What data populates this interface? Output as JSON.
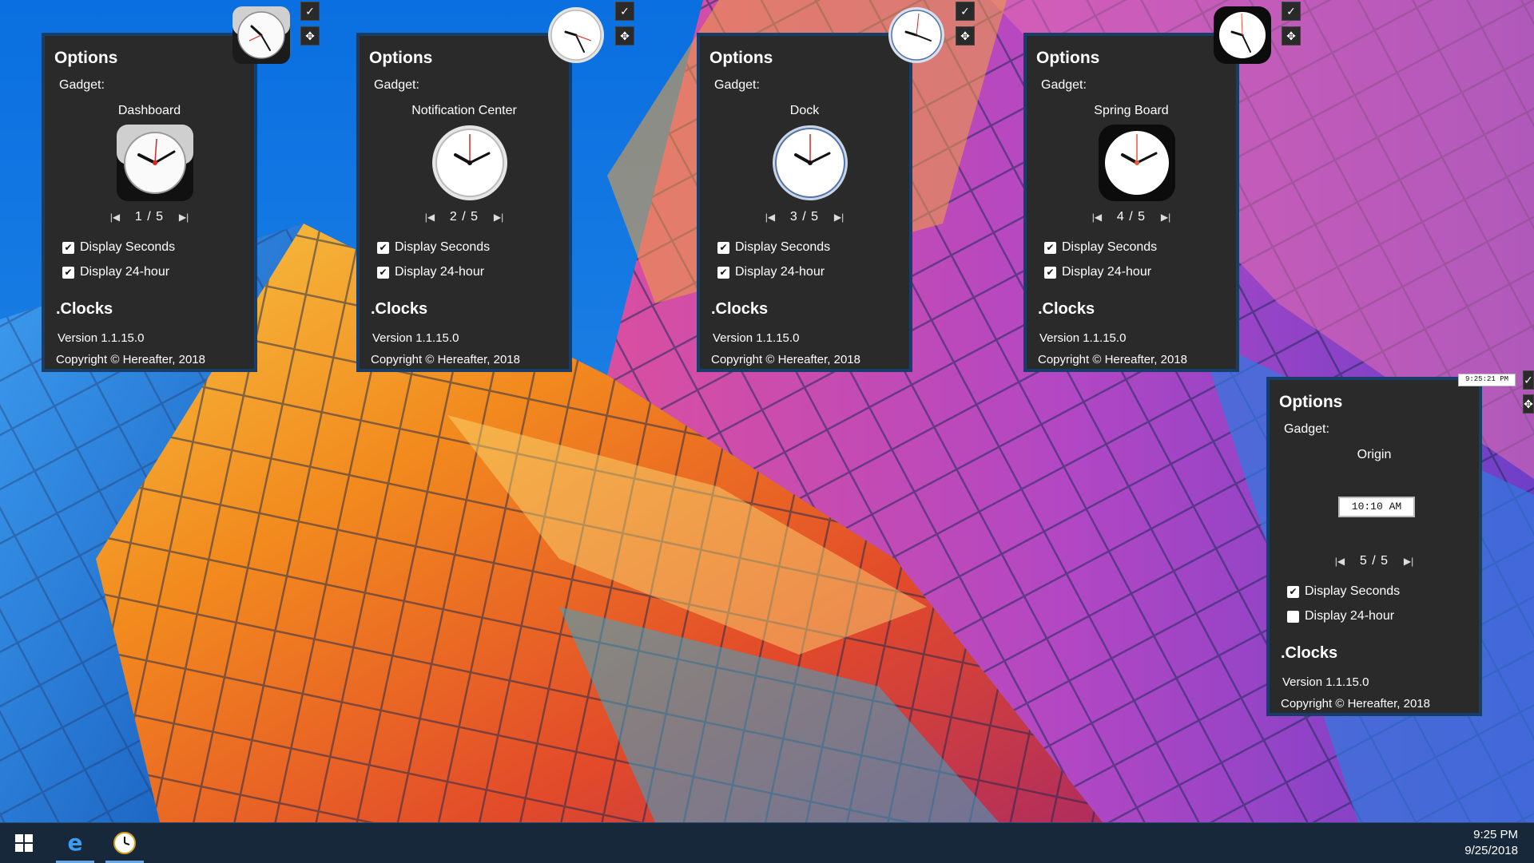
{
  "taskbar": {
    "time": "9:25 PM",
    "date": "9/25/2018",
    "items": [
      {
        "name": "start-button",
        "icon": "windows-logo-icon"
      },
      {
        "name": "edge-browser-button",
        "icon": "edge-browser-icon"
      },
      {
        "name": "clocks-app-button",
        "icon": "clock-icon"
      }
    ]
  },
  "panels": [
    {
      "title": "Options",
      "gadget_label": "Gadget:",
      "gadget_name": "Dashboard",
      "page": "1 / 5",
      "display_seconds_label": "Display Seconds",
      "display_seconds": true,
      "display_24h_label": "Display 24-hour",
      "display_24h": true,
      "app_name": ".Clocks",
      "version": "Version 1.1.15.0",
      "copyright": "Copyright ©  Hereafter, 2018"
    },
    {
      "title": "Options",
      "gadget_label": "Gadget:",
      "gadget_name": "Notification Center",
      "page": "2 / 5",
      "display_seconds_label": "Display Seconds",
      "display_seconds": true,
      "display_24h_label": "Display 24-hour",
      "display_24h": true,
      "app_name": ".Clocks",
      "version": "Version 1.1.15.0",
      "copyright": "Copyright ©  Hereafter, 2018"
    },
    {
      "title": "Options",
      "gadget_label": "Gadget:",
      "gadget_name": "Dock",
      "page": "3 / 5",
      "display_seconds_label": "Display Seconds",
      "display_seconds": true,
      "display_24h_label": "Display 24-hour",
      "display_24h": true,
      "app_name": ".Clocks",
      "version": "Version 1.1.15.0",
      "copyright": "Copyright ©  Hereafter, 2018"
    },
    {
      "title": "Options",
      "gadget_label": "Gadget:",
      "gadget_name": "Spring Board",
      "page": "4 / 5",
      "display_seconds_label": "Display Seconds",
      "display_seconds": true,
      "display_24h_label": "Display 24-hour",
      "display_24h": true,
      "app_name": ".Clocks",
      "version": "Version 1.1.15.0",
      "copyright": "Copyright ©  Hereafter, 2018"
    },
    {
      "title": "Options",
      "gadget_label": "Gadget:",
      "gadget_name": "Origin",
      "page": "5 / 5",
      "preview_time": "10:10 AM",
      "floating_time": "9:25:21 PM",
      "display_seconds_label": "Display Seconds",
      "display_seconds": true,
      "display_24h_label": "Display 24-hour",
      "display_24h": false,
      "app_name": ".Clocks",
      "version": "Version 1.1.15.0",
      "copyright": "Copyright ©  Hereafter, 2018"
    }
  ],
  "icons": {
    "confirm": "checkmark-icon",
    "move": "move-icon",
    "first": "first-page-icon",
    "last": "last-page-icon"
  },
  "colors": {
    "panel_bg": "#2a2a2a",
    "panel_border": "#173e68",
    "taskbar_bg": "#18283b",
    "taskbar_indicator": "#6aa6e8"
  }
}
